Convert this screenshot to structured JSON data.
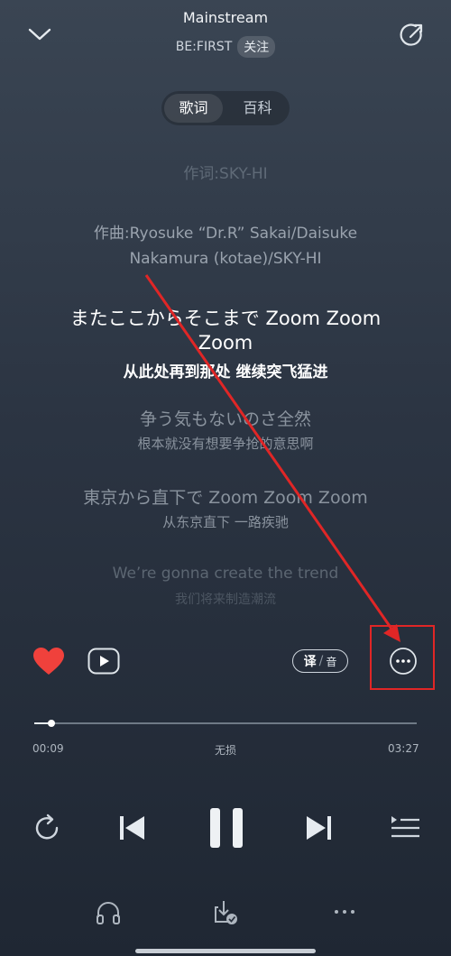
{
  "header": {
    "song_title": "Mainstream",
    "artist": "BE:FIRST",
    "follow_label": "关注"
  },
  "tabs": [
    {
      "label": "歌词",
      "active": true
    },
    {
      "label": "百科",
      "active": false
    }
  ],
  "lyrics": {
    "lyricist": "作词:SKY-HI",
    "composer_line1": "作曲:Ryosuke “Dr.R” Sakai/Daisuke",
    "composer_line2": "Nakamura (kotae)/SKY-HI",
    "current": {
      "line1": "またここからそこまで Zoom Zoom",
      "line2": "Zoom",
      "translation": "从此处再到那处 继续突飞猛进"
    },
    "next1": {
      "text": "争う気もないのさ全然",
      "translation": "根本就没有想要争抢的意思啊"
    },
    "next2": {
      "text": "東京から直下で Zoom Zoom Zoom",
      "translation": "从东京直下 一路疾驰"
    },
    "next3": {
      "text": "We’re gonna create the trend",
      "translation": "我们将来制造潮流"
    }
  },
  "actions": {
    "translate_label": "译",
    "phonetic_label": "音"
  },
  "progress": {
    "elapsed": "00:09",
    "total": "03:27",
    "quality": "无损",
    "fraction": 0.045
  },
  "colors": {
    "accent_heart": "#f0413c",
    "annotation": "#e02626"
  },
  "icons": {
    "collapse": "chevron-down-icon",
    "share": "share-icon",
    "like": "heart-icon",
    "video": "play-video-icon",
    "more": "more-icon",
    "repeat": "repeat-icon",
    "previous": "previous-icon",
    "pause": "pause-icon",
    "next": "next-icon",
    "playlist": "playlist-icon",
    "headphones": "headphones-icon",
    "download": "download-icon",
    "more_bottom": "more-icon"
  }
}
